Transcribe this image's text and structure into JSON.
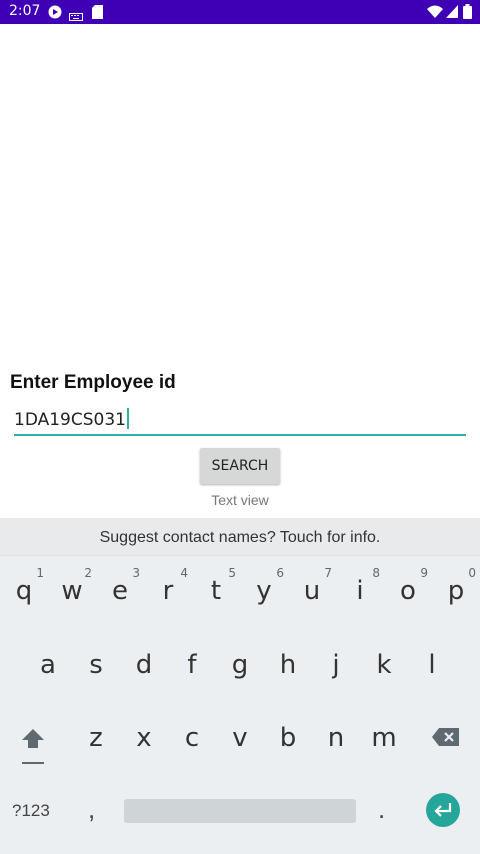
{
  "status_bar": {
    "time": "2:07"
  },
  "form": {
    "label": "Enter Employee id",
    "input_value": "1DA19CS031",
    "button_label": "SEARCH",
    "text_view": "Text view"
  },
  "keyboard": {
    "suggestion": "Suggest contact names? Touch for info.",
    "row1": [
      {
        "ch": "q",
        "hint": "1"
      },
      {
        "ch": "w",
        "hint": "2"
      },
      {
        "ch": "e",
        "hint": "3"
      },
      {
        "ch": "r",
        "hint": "4"
      },
      {
        "ch": "t",
        "hint": "5"
      },
      {
        "ch": "y",
        "hint": "6"
      },
      {
        "ch": "u",
        "hint": "7"
      },
      {
        "ch": "i",
        "hint": "8"
      },
      {
        "ch": "o",
        "hint": "9"
      },
      {
        "ch": "p",
        "hint": "0"
      }
    ],
    "row2": [
      "a",
      "s",
      "d",
      "f",
      "g",
      "h",
      "j",
      "k",
      "l"
    ],
    "row3": [
      "z",
      "x",
      "c",
      "v",
      "b",
      "n",
      "m"
    ],
    "symbols_label": "?123",
    "comma": ",",
    "period": "."
  },
  "colors": {
    "status_bar": "#3f00b5",
    "accent": "#2bb3a8",
    "enter": "#26a69a"
  }
}
